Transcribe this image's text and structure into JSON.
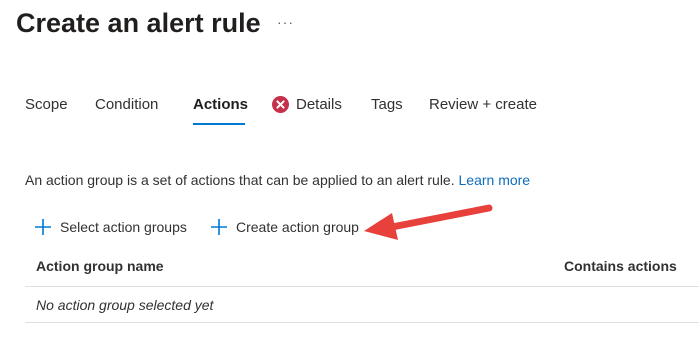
{
  "page": {
    "title": "Create an alert rule",
    "more_label": "···"
  },
  "tabs": [
    {
      "label": "Scope",
      "active": false
    },
    {
      "label": "Condition",
      "active": false
    },
    {
      "label": "Actions",
      "active": true
    },
    {
      "label": "Details",
      "active": false,
      "status_icon": "error-icon",
      "status_color": "#c4314b"
    },
    {
      "label": "Tags",
      "active": false
    },
    {
      "label": "Review + create",
      "active": false
    }
  ],
  "description": {
    "text": "An action group is a set of actions that can be applied to an alert rule.",
    "link": "Learn more"
  },
  "commands": {
    "select_label": "Select action groups",
    "create_label": "Create action group",
    "icon": "plus-icon",
    "icon_color": "#0078d4"
  },
  "table": {
    "columns": [
      "Action group name",
      "Contains actions"
    ],
    "empty_text": "No action group selected yet"
  },
  "annotation": {
    "arrow_color": "#e8413c"
  }
}
